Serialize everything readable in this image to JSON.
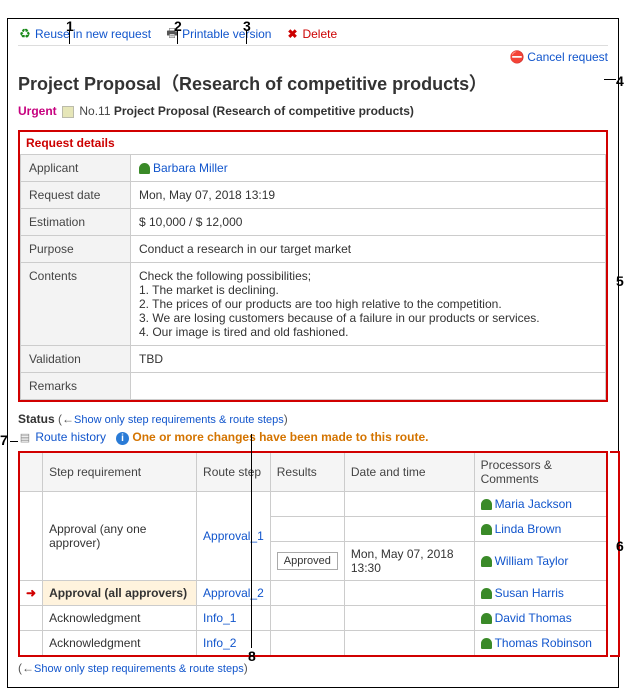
{
  "callouts": {
    "c1": "1",
    "c2": "2",
    "c3": "3",
    "c4": "4",
    "c5": "5",
    "c6": "6",
    "c7": "7",
    "c8": "8"
  },
  "actions": {
    "reuse": "Reuse in new request",
    "printable": "Printable version",
    "delete": "Delete",
    "cancel": "Cancel request"
  },
  "title": "Project Proposal（Research of competitive products）",
  "subline": {
    "urgent": "Urgent",
    "no_label": "No.11",
    "name": "Project Proposal (Research of competitive products)"
  },
  "details_section_title": "Request details",
  "details": {
    "applicant_label": "Applicant",
    "applicant_value": "Barbara Miller",
    "request_date_label": "Request date",
    "request_date_value": "Mon, May 07, 2018 13:19",
    "estimation_label": "Estimation",
    "estimation_value": "$ 10,000  /  $ 12,000",
    "purpose_label": "Purpose",
    "purpose_value": "Conduct a research in our target market",
    "contents_label": "Contents",
    "contents_value": "Check the following possibilities;\n1. The market is declining.\n2. The prices of our products are too high relative to the competition.\n3. We are losing customers because of a failure in our products or services.\n4. Our image is tired and old fashioned.",
    "validation_label": "Validation",
    "validation_value": "TBD",
    "remarks_label": "Remarks",
    "remarks_value": ""
  },
  "status": {
    "label": "Status",
    "toggle_label": "Show only step requirements & route steps"
  },
  "route_history_label": "Route history",
  "change_notice": "One or more changes have been made to this route.",
  "steps_header": {
    "arrow": "",
    "requirement": "Step requirement",
    "route_step": "Route step",
    "results": "Results",
    "datetime": "Date and time",
    "processors": "Processors & Comments"
  },
  "steps": [
    {
      "arrow": "",
      "requirement": "",
      "route_step": "",
      "results": "",
      "datetime": "",
      "processor": "Maria Jackson"
    },
    {
      "arrow": "",
      "requirement": "Approval (any one approver)",
      "route_step": "Approval_1",
      "results": "",
      "datetime": "",
      "processor": "Linda Brown"
    },
    {
      "arrow": "",
      "requirement": "",
      "route_step": "",
      "results": "Approved",
      "datetime": "Mon, May 07, 2018 13:30",
      "processor": "William Taylor"
    },
    {
      "arrow": "➜",
      "requirement": "Approval (all approvers)",
      "route_step": "Approval_2",
      "results": "",
      "datetime": "",
      "processor": "Susan Harris",
      "highlight": true
    },
    {
      "arrow": "",
      "requirement": "Acknowledgment",
      "route_step": "Info_1",
      "results": "",
      "datetime": "",
      "processor": "David Thomas"
    },
    {
      "arrow": "",
      "requirement": "Acknowledgment",
      "route_step": "Info_2",
      "results": "",
      "datetime": "",
      "processor": "Thomas Robinson"
    }
  ],
  "bottom_toggle": "Show only step requirements & route steps"
}
